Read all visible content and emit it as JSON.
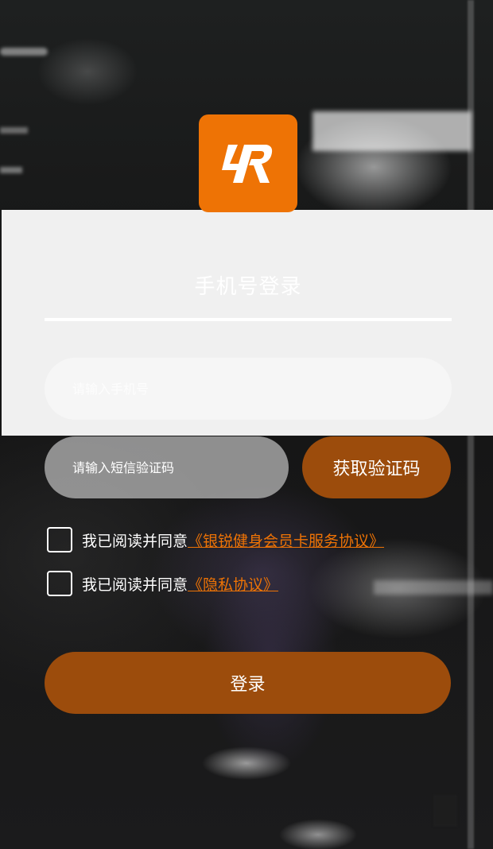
{
  "logo": {
    "icon": "brand-logo-icon",
    "color": "#ee7305"
  },
  "login_form": {
    "title": "手机号登录",
    "phone_placeholder": "请输入手机号",
    "code_placeholder": "请输入短信验证码",
    "get_code_label": "获取验证码",
    "login_label": "登录"
  },
  "agreements": [
    {
      "prefix": "我已阅读并同意",
      "link": "《银锐健身会员卡服务协议》",
      "checked": false
    },
    {
      "prefix": "我已阅读并同意",
      "link": "《隐私协议》",
      "checked": false
    }
  ],
  "colors": {
    "accent": "#ee7305",
    "button": "#9c4c0c",
    "panel": "#f0f0f0"
  }
}
